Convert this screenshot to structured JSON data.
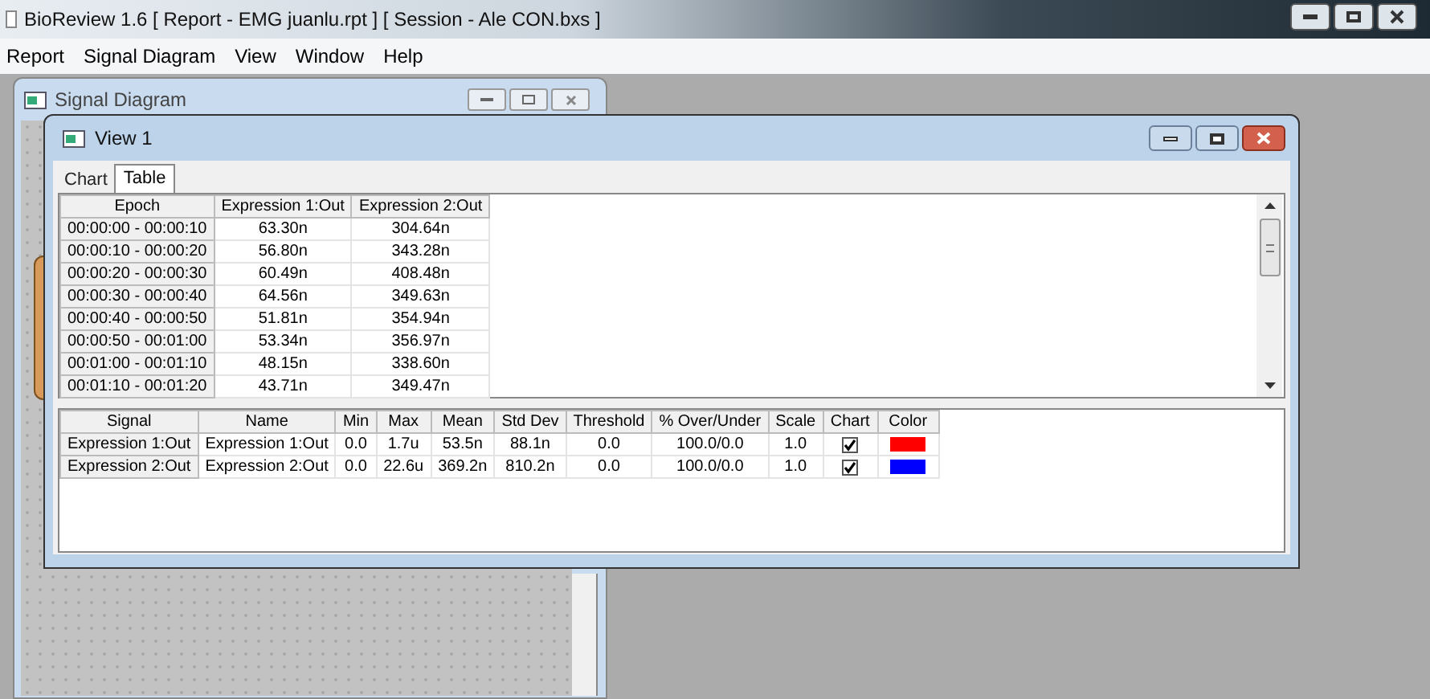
{
  "window": {
    "title": "BioReview 1.6  [ Report - EMG juanlu.rpt ] [ Session - Ale CON.bxs ]"
  },
  "menu": [
    "Report",
    "Signal Diagram",
    "View",
    "Window",
    "Help"
  ],
  "signal_diagram_window": {
    "title": "Signal Diagram"
  },
  "view_window": {
    "title": "View 1"
  },
  "tabs": [
    {
      "label": "Chart",
      "selected": false
    },
    {
      "label": "Table",
      "selected": true
    }
  ],
  "epoch_table": {
    "columns": [
      "Epoch",
      "Expression 1:Out",
      "Expression 2:Out"
    ],
    "rows": [
      [
        "00:00:00 - 00:00:10",
        "63.30n",
        "304.64n"
      ],
      [
        "00:00:10 - 00:00:20",
        "56.80n",
        "343.28n"
      ],
      [
        "00:00:20 - 00:00:30",
        "60.49n",
        "408.48n"
      ],
      [
        "00:00:30 - 00:00:40",
        "64.56n",
        "349.63n"
      ],
      [
        "00:00:40 - 00:00:50",
        "51.81n",
        "354.94n"
      ],
      [
        "00:00:50 - 00:01:00",
        "53.34n",
        "356.97n"
      ],
      [
        "00:01:00 - 00:01:10",
        "48.15n",
        "338.60n"
      ],
      [
        "00:01:10 - 00:01:20",
        "43.71n",
        "349.47n"
      ]
    ]
  },
  "signal_table": {
    "columns": [
      "Signal",
      "Name",
      "Min",
      "Max",
      "Mean",
      "Std Dev",
      "Threshold",
      "% Over/Under",
      "Scale",
      "Chart",
      "Color"
    ],
    "rows": [
      {
        "signal": "Expression 1:Out",
        "name": "Expression 1:Out",
        "min": "0.0",
        "max": "1.7u",
        "mean": "53.5n",
        "std_dev": "88.1n",
        "threshold": "0.0",
        "over_under": "100.0/0.0",
        "scale": "1.0",
        "chart": true,
        "color": "#ff0000"
      },
      {
        "signal": "Expression 2:Out",
        "name": "Expression 2:Out",
        "min": "0.0",
        "max": "22.6u",
        "mean": "369.2n",
        "std_dev": "810.2n",
        "threshold": "0.0",
        "over_under": "100.0/0.0",
        "scale": "1.0",
        "chart": true,
        "color": "#0000ff"
      }
    ]
  }
}
